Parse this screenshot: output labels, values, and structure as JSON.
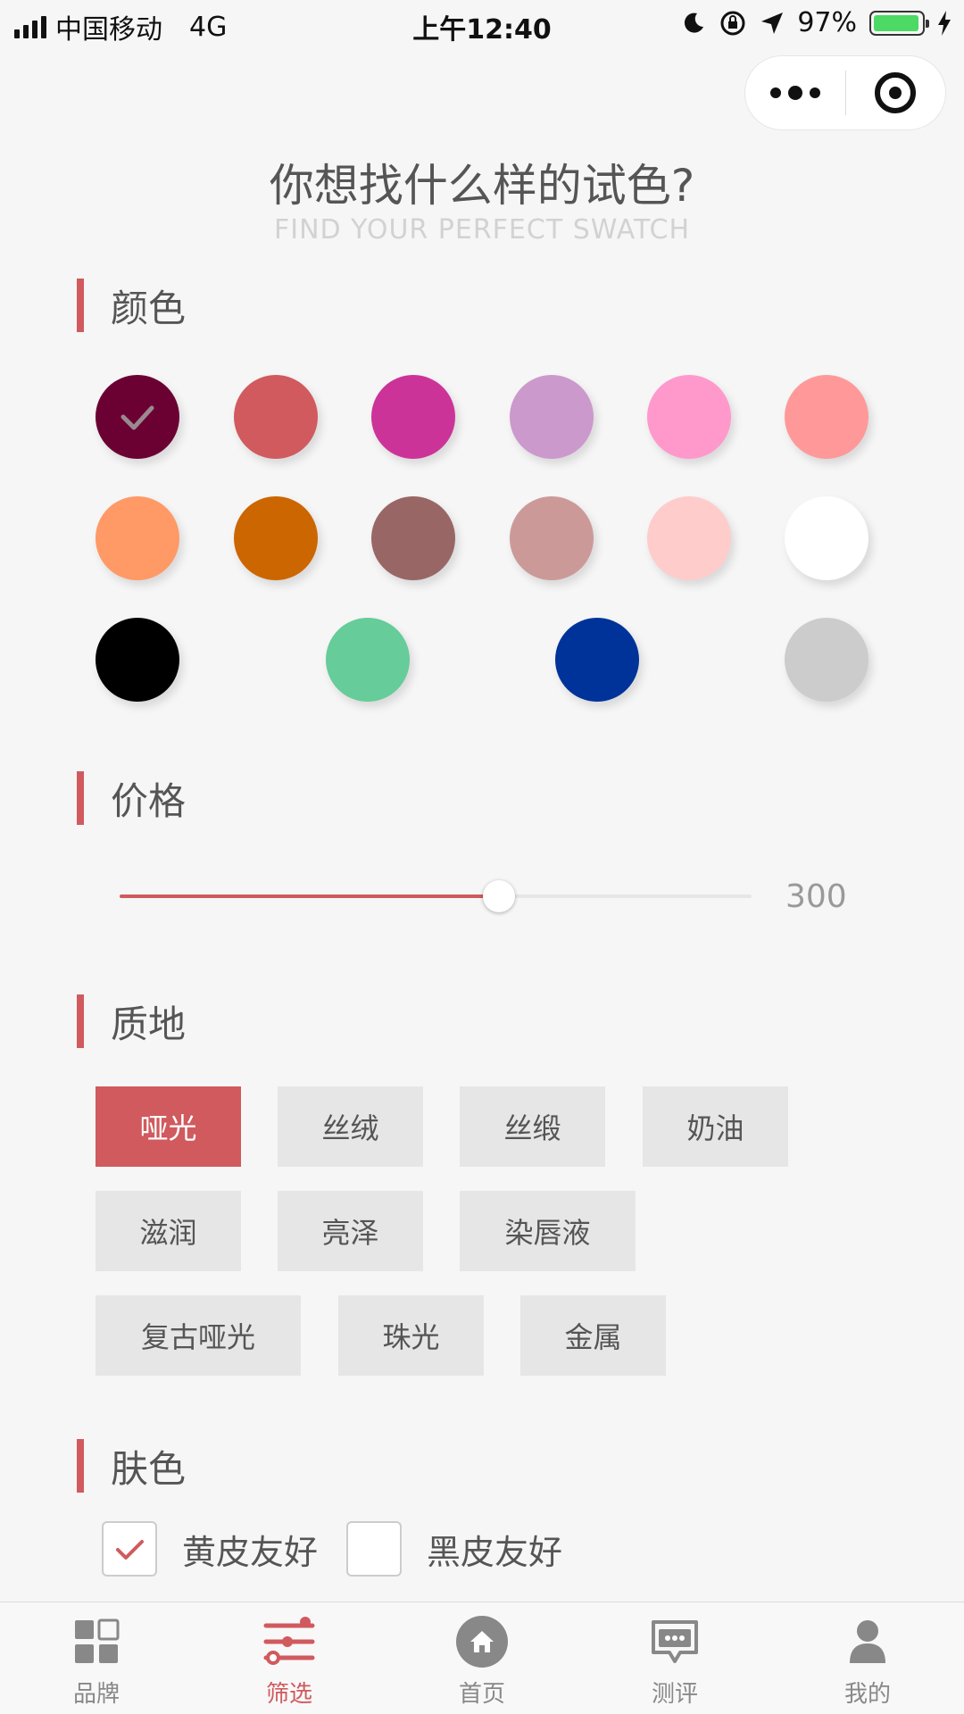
{
  "status_bar": {
    "carrier": "中国移动",
    "network": "4G",
    "time": "上午12:40",
    "battery": "97%",
    "battery_level": 0.97
  },
  "header": {
    "title": "你想找什么样的试色?",
    "subtitle": "FIND YOUR PERFECT SWATCH"
  },
  "color_section": {
    "label": "颜色",
    "swatches": [
      "#6b0033",
      "#d05a5e",
      "#cc3399",
      "#cc99cc",
      "#ff99cc",
      "#ff9999",
      "#ff9966",
      "#cc6600",
      "#996666",
      "#cc9999",
      "#ffcccc",
      "#ffffff",
      "#000000",
      "#66cc99",
      "#003399",
      "#cccccc"
    ],
    "selected_index": 0
  },
  "price_section": {
    "label": "价格",
    "value": "300",
    "slider_fraction": 0.6
  },
  "texture_section": {
    "label": "质地",
    "options": [
      "哑光",
      "丝绒",
      "丝缎",
      "奶油",
      "滋润",
      "亮泽",
      "染唇液",
      "复古哑光",
      "珠光",
      "金属"
    ],
    "selected_index": 0
  },
  "skin_section": {
    "label": "肤色",
    "options": [
      {
        "label": "黄皮友好",
        "checked": true
      },
      {
        "label": "黑皮友好",
        "checked": false
      }
    ]
  },
  "tabbar": {
    "items": [
      {
        "label": "品牌",
        "icon": "grid-icon"
      },
      {
        "label": "筛选",
        "icon": "filter-icon"
      },
      {
        "label": "首页",
        "icon": "home-icon"
      },
      {
        "label": "测评",
        "icon": "review-icon"
      },
      {
        "label": "我的",
        "icon": "user-icon"
      }
    ],
    "active_index": 1
  },
  "accent_color": "#d05a5e"
}
